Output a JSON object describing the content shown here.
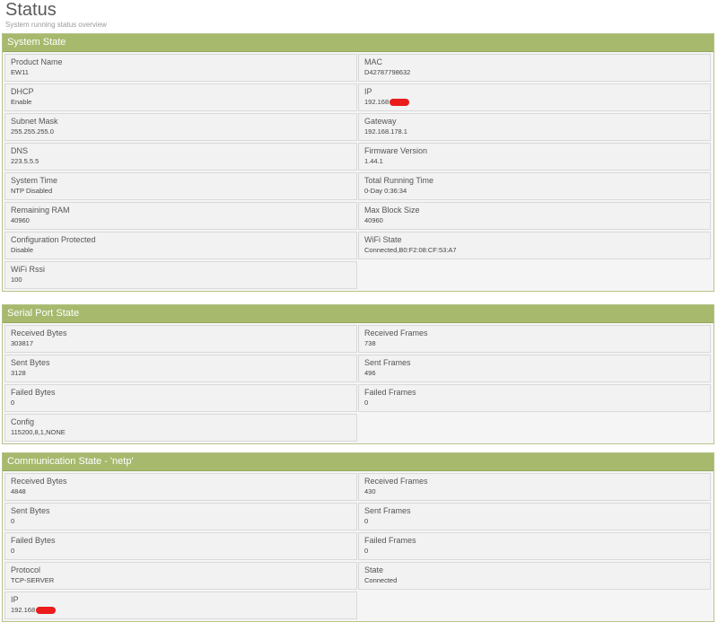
{
  "page": {
    "title": "Status",
    "subtitle": "System running status overview"
  },
  "system_state": {
    "heading": "System State",
    "fields": [
      {
        "label": "Product Name",
        "value": "EW11"
      },
      {
        "label": "MAC",
        "value": "D42787798632"
      },
      {
        "label": "DHCP",
        "value": "Enable"
      },
      {
        "label": "IP",
        "value": "192.168"
      },
      {
        "label": "Subnet Mask",
        "value": "255.255.255.0"
      },
      {
        "label": "Gateway",
        "value": "192.168.178.1"
      },
      {
        "label": "DNS",
        "value": "223.5.5.5"
      },
      {
        "label": "Firmware Version",
        "value": "1.44.1"
      },
      {
        "label": "System Time",
        "value": "NTP Disabled"
      },
      {
        "label": "Total Running Time",
        "value": "0-Day 0:36:34"
      },
      {
        "label": "Remaining RAM",
        "value": "40960"
      },
      {
        "label": "Max Block Size",
        "value": "40960"
      },
      {
        "label": "Configuration Protected",
        "value": "Disable"
      },
      {
        "label": "WiFi State",
        "value": "Connected,B0:F2:08:CF:53:A7"
      },
      {
        "label": "WiFi Rssi",
        "value": "100"
      }
    ]
  },
  "serial_port_state": {
    "heading": "Serial Port State",
    "fields": [
      {
        "label": "Received Bytes",
        "value": "303817"
      },
      {
        "label": "Received Frames",
        "value": "738"
      },
      {
        "label": "Sent Bytes",
        "value": "3128"
      },
      {
        "label": "Sent Frames",
        "value": "496"
      },
      {
        "label": "Failed Bytes",
        "value": "0"
      },
      {
        "label": "Failed Frames",
        "value": "0"
      },
      {
        "label": "Config",
        "value": "115200,8,1,NONE"
      }
    ]
  },
  "communication_state": {
    "heading": "Communication State - 'netp'",
    "fields": [
      {
        "label": "Received Bytes",
        "value": "4848"
      },
      {
        "label": "Received Frames",
        "value": "430"
      },
      {
        "label": "Sent Bytes",
        "value": "0"
      },
      {
        "label": "Sent Frames",
        "value": "0"
      },
      {
        "label": "Failed Bytes",
        "value": "0"
      },
      {
        "label": "Failed Frames",
        "value": "0"
      },
      {
        "label": "Protocol",
        "value": "TCP-SERVER"
      },
      {
        "label": "State",
        "value": "Connected"
      },
      {
        "label": "IP",
        "value": "192.168"
      }
    ]
  },
  "colors": {
    "panel_header": "#a6b96d",
    "redaction": "#ea1c1c"
  }
}
